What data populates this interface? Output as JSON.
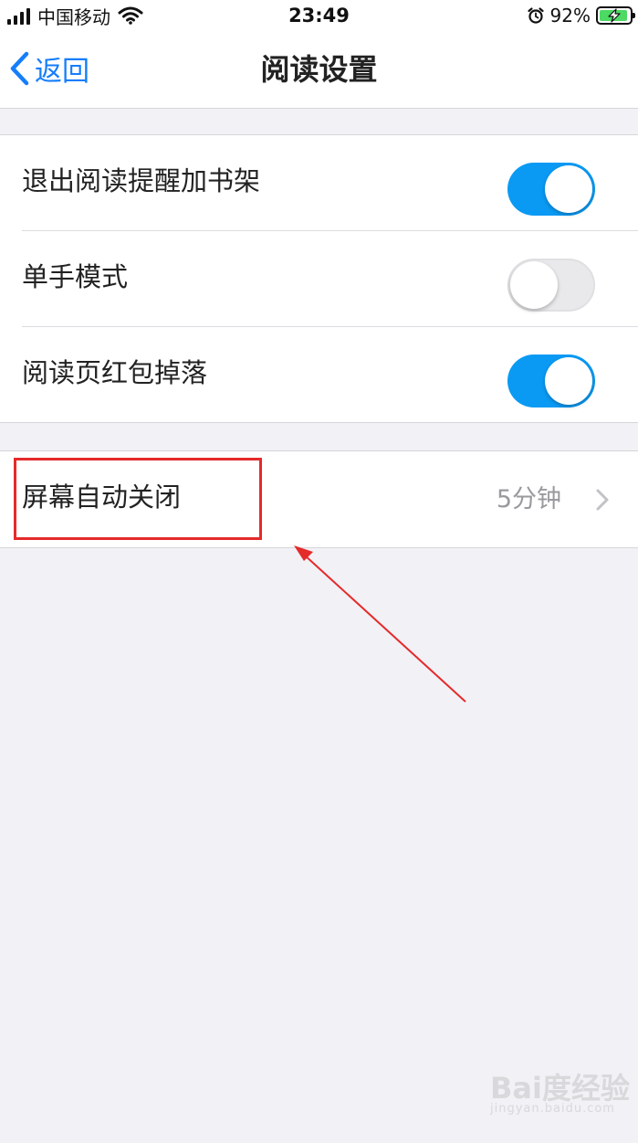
{
  "status_bar": {
    "carrier": "中国移动",
    "time": "23:49",
    "battery_percent": "92%",
    "battery_level": 0.92,
    "icons": [
      "signal-icon",
      "wifi-icon",
      "alarm-icon",
      "battery-charging-icon"
    ]
  },
  "nav": {
    "back_label": "返回",
    "title": "阅读设置"
  },
  "settings": {
    "rows": [
      {
        "label": "退出阅读提醒加书架",
        "toggle": true
      },
      {
        "label": "单手模式",
        "toggle": false
      },
      {
        "label": "阅读页红包掉落",
        "toggle": true
      }
    ],
    "screen_off": {
      "label": "屏幕自动关闭",
      "value": "5分钟"
    }
  },
  "colors": {
    "accent": "#0a9af4",
    "back_link": "#157efb",
    "annotation": "#e52a2a",
    "background": "#f1f1f6"
  },
  "watermark": {
    "text": "Bai度经验",
    "sub": "jingyan.baidu.com"
  }
}
